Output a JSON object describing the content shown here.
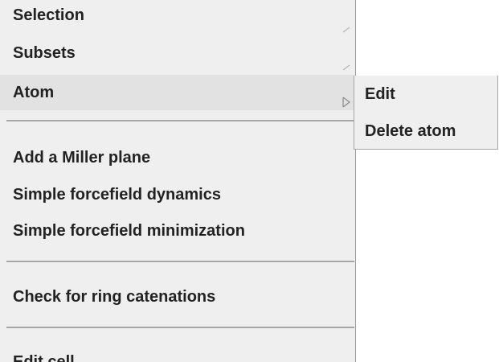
{
  "context_menu": {
    "items": [
      {
        "label": "Selection",
        "has_submenu": true
      },
      {
        "label": "Subsets",
        "has_submenu": true
      },
      {
        "label": "Atom",
        "has_submenu": true,
        "highlighted": true
      },
      {
        "label": "Add a Miller plane"
      },
      {
        "label": "Simple forcefield dynamics"
      },
      {
        "label": "Simple forcefield minimization"
      },
      {
        "label": "Check for ring catenations"
      },
      {
        "label": "Edit cell"
      }
    ],
    "submenu_arrow_icon": "chevron-right-icon"
  },
  "atom_submenu": {
    "items": [
      {
        "label": "Edit"
      },
      {
        "label": "Delete atom"
      }
    ]
  },
  "colors": {
    "menu_background": "#efefef",
    "highlight_background": "#e2e2e2",
    "separator": "#a6a6a6",
    "text": "#222222"
  }
}
